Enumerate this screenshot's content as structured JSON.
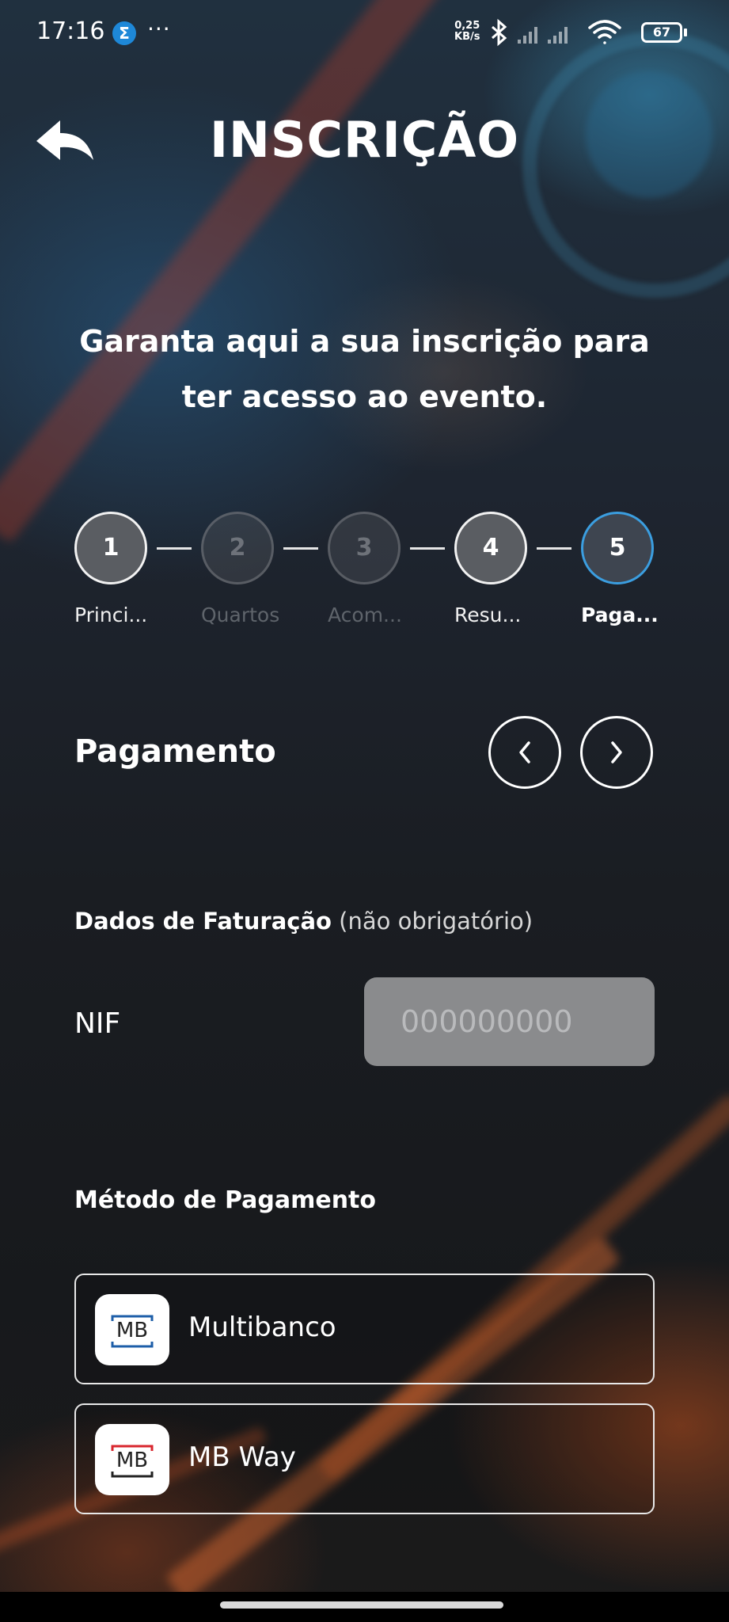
{
  "status_bar": {
    "time": "17:16",
    "app_icon": "sigma-icon",
    "more": "···",
    "net_speed_value": "0,25",
    "net_speed_unit": "KB/s",
    "battery": "67"
  },
  "header": {
    "back_icon": "back-arrow-icon",
    "title": "INSCRIÇÃO"
  },
  "intro": {
    "text": "Garanta aqui a sua inscrição para ter acesso ao evento."
  },
  "stepper": {
    "steps": [
      {
        "number": "1",
        "label": "Princi...",
        "state": "done"
      },
      {
        "number": "2",
        "label": "Quartos",
        "state": "disabled"
      },
      {
        "number": "3",
        "label": "Acom...",
        "state": "disabled"
      },
      {
        "number": "4",
        "label": "Resu...",
        "state": "done"
      },
      {
        "number": "5",
        "label": "Paga...",
        "state": "current"
      }
    ],
    "current_border_color": "#3b9ee0"
  },
  "section": {
    "title": "Pagamento",
    "prev_icon": "chevron-left-icon",
    "next_icon": "chevron-right-icon"
  },
  "billing": {
    "label": "Dados de Faturação",
    "optional_note": "(não obrigatório)",
    "nif_label": "NIF",
    "nif_value": "",
    "nif_placeholder": "000000000"
  },
  "payment": {
    "title": "Método de Pagamento",
    "methods": [
      {
        "label": "Multibanco",
        "logo_text": "MB",
        "icon": "multibanco-logo-icon",
        "accent": "#1d5ea8"
      },
      {
        "label": "MB Way",
        "logo_text": "MB",
        "icon": "mbway-logo-icon",
        "accent": "#d8262e"
      }
    ]
  }
}
